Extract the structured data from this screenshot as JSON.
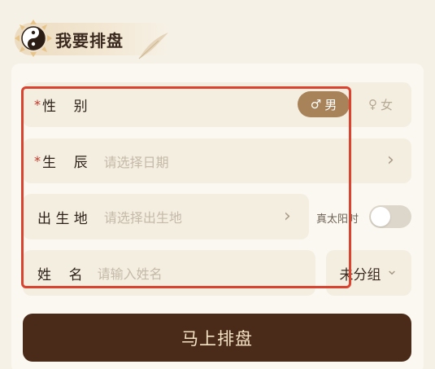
{
  "header": {
    "title": "我要排盘"
  },
  "form": {
    "gender": {
      "required_mark": "*",
      "label": "性    别",
      "male": "男",
      "female": "女",
      "male_symbol": "♂",
      "female_symbol": "♀"
    },
    "birth": {
      "required_mark": "*",
      "label": "生    辰",
      "placeholder": "请选择日期",
      "chevron": "›"
    },
    "birthplace": {
      "label": "出 生 地",
      "placeholder": "请选择出生地",
      "chevron": "›"
    },
    "solar_time": {
      "label": "真太阳时"
    },
    "name": {
      "label": "姓    名",
      "placeholder": "请输入姓名"
    },
    "group": {
      "label": "未分组",
      "chevron": "⌄"
    }
  },
  "submit": {
    "label": "马上排盘"
  },
  "colors": {
    "accent": "#a8835a",
    "button": "#4a2a18",
    "required": "#c0392b",
    "highlight": "#d9432f"
  }
}
